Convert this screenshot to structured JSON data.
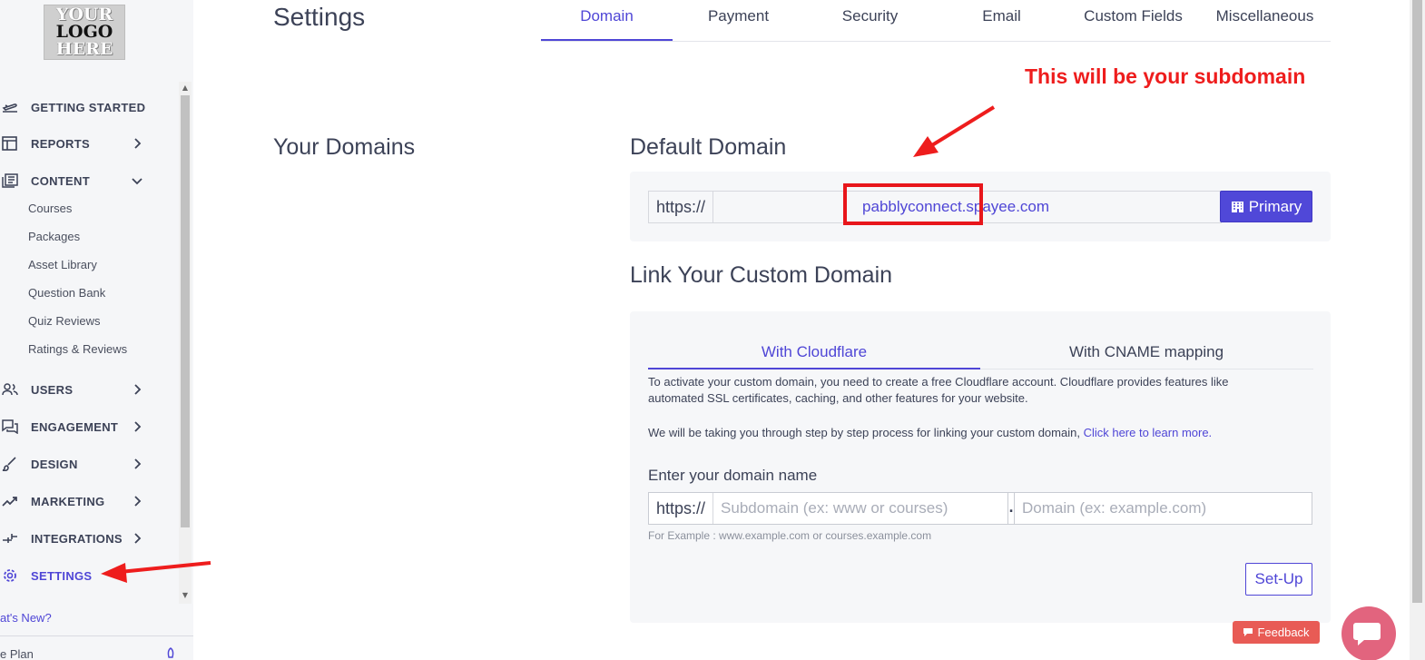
{
  "logo": {
    "line1": "YOUR",
    "line2": "LOGO",
    "line3": "HERE"
  },
  "sidebar": {
    "items": [
      {
        "label": "GETTING STARTED"
      },
      {
        "label": "REPORTS"
      },
      {
        "label": "CONTENT"
      },
      {
        "label": "USERS"
      },
      {
        "label": "ENGAGEMENT"
      },
      {
        "label": "DESIGN"
      },
      {
        "label": "MARKETING"
      },
      {
        "label": "INTEGRATIONS"
      },
      {
        "label": "SETTINGS"
      }
    ],
    "content_sub": [
      "Courses",
      "Packages",
      "Asset Library",
      "Question Bank",
      "Quiz Reviews",
      "Ratings & Reviews"
    ],
    "whats_new": "at's New?",
    "plan": "e Plan"
  },
  "page": {
    "title": "Settings"
  },
  "tabs": [
    "Domain",
    "Payment",
    "Security",
    "Email",
    "Custom Fields",
    "Miscellaneous"
  ],
  "annotation": {
    "text": "This will be your subdomain"
  },
  "domains": {
    "section_title": "Your Domains",
    "default_title": "Default Domain",
    "prefix": "https://",
    "value": "pabblyconnect.spayee.com",
    "primary_label": "Primary"
  },
  "custom": {
    "title": "Link Your Custom Domain",
    "tabs": [
      "With Cloudflare",
      "With CNAME mapping"
    ],
    "para1": "To activate your custom domain, you need to create a free Cloudflare account. Cloudflare provides features like automated SSL certificates, caching, and other features for your website.",
    "para2": "We will be taking you through step by step process for linking your custom domain, ",
    "link": "Click here to learn more.",
    "field_label": "Enter your domain name",
    "prefix": "https://",
    "subdomain_placeholder": "Subdomain (ex: www or courses)",
    "dot": ".",
    "domain_placeholder": "Domain (ex: example.com)",
    "example": "For Example : www.example.com or courses.example.com",
    "setup_label": "Set-Up"
  },
  "feedback_label": "Feedback",
  "colors": {
    "accent": "#4f46d6",
    "annotation": "#ee1d1d",
    "feedback": "#e85b55"
  }
}
